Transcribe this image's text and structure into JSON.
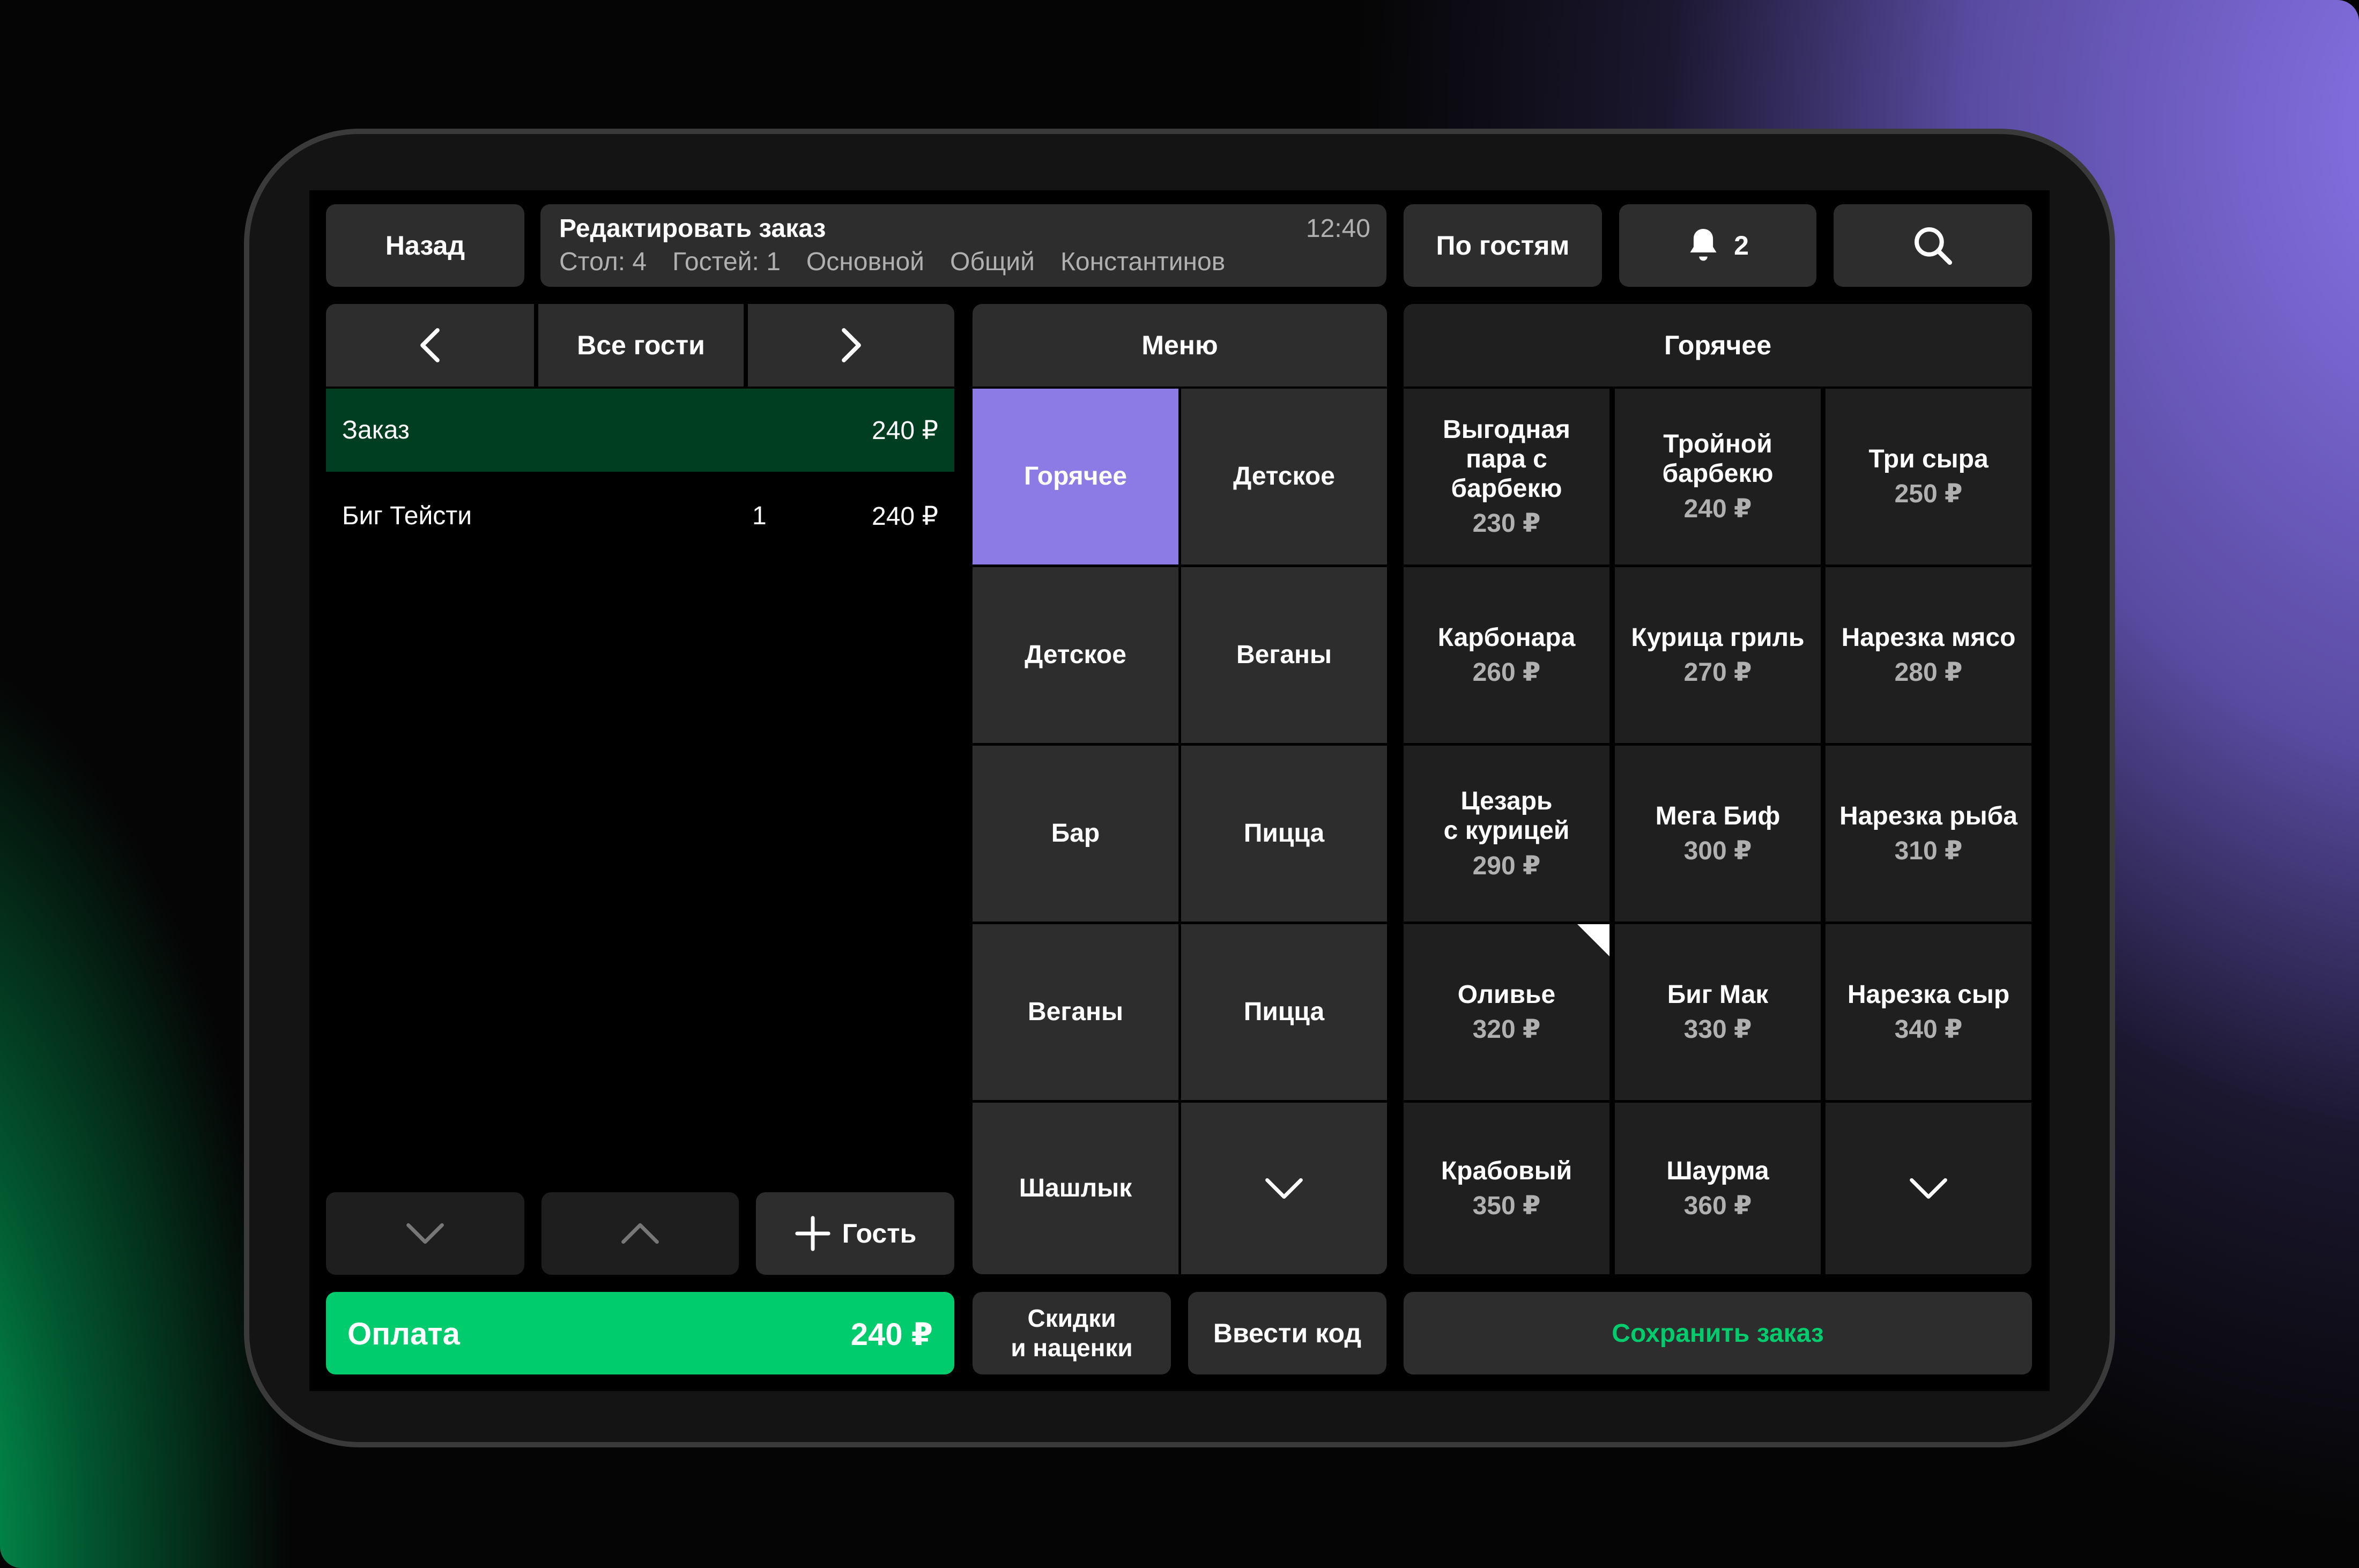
{
  "header": {
    "back_label": "Назад",
    "title": "Редактировать заказ",
    "time": "12:40",
    "meta": [
      "Стол: 4",
      "Гостей: 1",
      "Основной",
      "Общий",
      "Константинов"
    ],
    "by_guests_label": "По гостям",
    "notifications_count": "2"
  },
  "guests": {
    "current_label": "Все гости",
    "order_label": "Заказ",
    "order_total": "240 ₽",
    "items": [
      {
        "name": "Биг Тейсти",
        "qty": "1",
        "price": "240 ₽"
      }
    ],
    "add_guest_label": "Гость"
  },
  "payment": {
    "label": "Оплата",
    "total": "240 ₽"
  },
  "actions": {
    "discounts_line1": "Скидки",
    "discounts_line2": "и наценки",
    "enter_code": "Ввести код",
    "save_order": "Сохранить заказ"
  },
  "menu": {
    "title": "Меню",
    "categories": [
      "Горячее",
      "Детское",
      "Детское",
      "Веганы",
      "Бар",
      "Пицца",
      "Веганы",
      "Пицца",
      "Шашлык"
    ],
    "active_index": 0
  },
  "dishes": {
    "title": "Горячее",
    "items": [
      {
        "name1": "Выгодная",
        "name2": "пара с",
        "name3": "барбекю",
        "price": "230 ₽"
      },
      {
        "name1": "Тройной",
        "name2": "барбекю",
        "name3": "",
        "price": "240 ₽"
      },
      {
        "name1": "Три сыра",
        "name2": "",
        "name3": "",
        "price": "250 ₽"
      },
      {
        "name1": "Карбонара",
        "name2": "",
        "name3": "",
        "price": "260 ₽"
      },
      {
        "name1": "Курица гриль",
        "name2": "",
        "name3": "",
        "price": "270 ₽"
      },
      {
        "name1": "Нарезка мясо",
        "name2": "",
        "name3": "",
        "price": "280 ₽"
      },
      {
        "name1": "Цезарь",
        "name2": "с курицей",
        "name3": "",
        "price": "290 ₽"
      },
      {
        "name1": "Мега Биф",
        "name2": "",
        "name3": "",
        "price": "300 ₽"
      },
      {
        "name1": "Нарезка рыба",
        "name2": "",
        "name3": "",
        "price": "310 ₽"
      },
      {
        "name1": "Оливье",
        "name2": "",
        "name3": "",
        "price": "320 ₽"
      },
      {
        "name1": "Биг Мак",
        "name2": "",
        "name3": "",
        "price": "330 ₽"
      },
      {
        "name1": "Нарезка сыр",
        "name2": "",
        "name3": "",
        "price": "340 ₽"
      },
      {
        "name1": "Крабовый",
        "name2": "",
        "name3": "",
        "price": "350 ₽"
      },
      {
        "name1": "Шаурма",
        "name2": "",
        "name3": "",
        "price": "360 ₽"
      }
    ]
  },
  "icons": [
    "chevron-left-icon",
    "chevron-right-icon",
    "chevron-down-icon",
    "chevron-up-icon",
    "plus-icon",
    "bell-icon",
    "search-icon"
  ],
  "colors": {
    "accent_green": "#00cc6e",
    "accent_purple": "#8c7be4",
    "order_row": "#003e22"
  }
}
